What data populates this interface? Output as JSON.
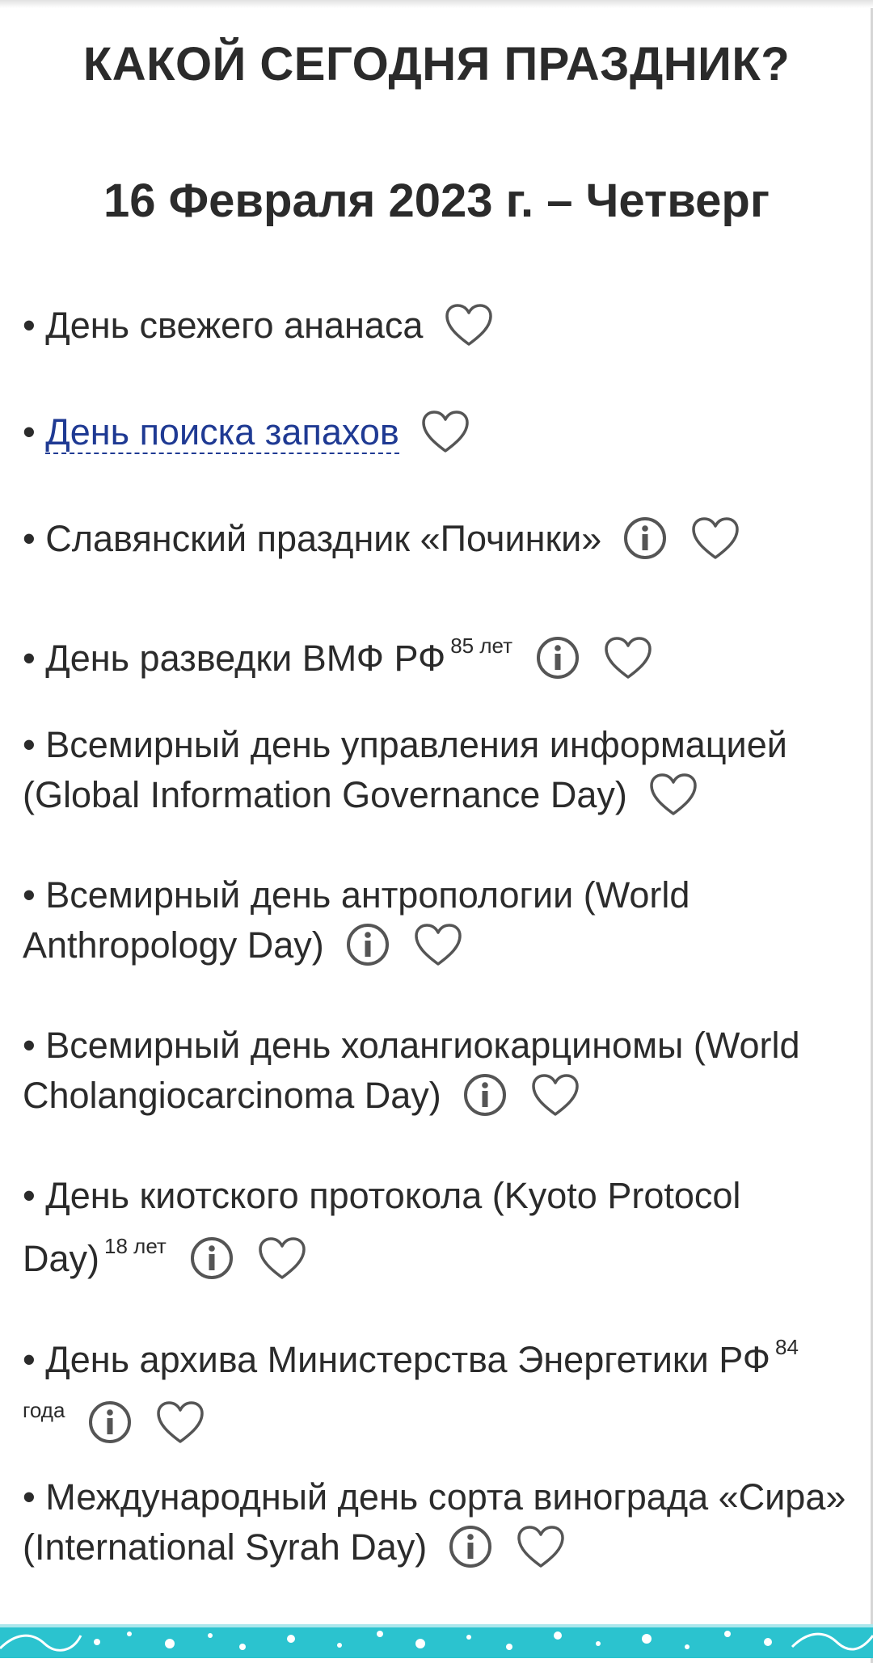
{
  "page": {
    "title": "КАКОЙ СЕГОДНЯ ПРАЗДНИК?",
    "date": "16 Февраля 2023 г. – Четверг"
  },
  "holidays": [
    {
      "text": "• День свежего ананаса"
    },
    {
      "bullet": "• ",
      "link_text": "День поиска запахов"
    },
    {
      "text": "• Славянский праздник «Починки»"
    },
    {
      "text": "• День разведки ВМФ РФ",
      "age": "85 лет"
    },
    {
      "text": "• Всемирный день управления информацией (Global Information Governance Day)"
    },
    {
      "text": "• Всемирный день антропологии (World Anthropology Day)"
    },
    {
      "text": "• Всемирный день холангиокарциномы (World Cholangiocarcinoma Day)"
    },
    {
      "text": "• День киотского протокола (Kyoto Protocol Day)",
      "age": "18 лет"
    },
    {
      "text": "• День архива Министерства Энергетики РФ",
      "age": "84 года"
    },
    {
      "text": "• Международный день сорта винограда «Сира» (International Syrah Day)"
    }
  ],
  "icons": {
    "info": "info-icon",
    "heart": "heart-outline-icon"
  },
  "colors": {
    "text": "#2b2b2b",
    "link": "#1f3a93",
    "icon": "#555555",
    "footer": "#2bc3cf"
  }
}
